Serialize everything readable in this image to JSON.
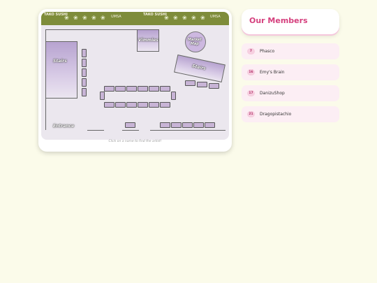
{
  "map": {
    "banner_text": "TAKO\nSUSHI",
    "logo_text": "UMSA",
    "labels": {
      "stairs_left": "Stairs",
      "stairs_right": "Stairs",
      "vimmies": "Vimmies",
      "market_map": "Market\nMap",
      "entrance": "Entrance"
    },
    "hint": "Click on a name to find the artist!"
  },
  "members": {
    "title": "Our Members",
    "items": [
      {
        "number": "7",
        "name": "Phasco"
      },
      {
        "number": "16",
        "name": "Emy's Brain"
      },
      {
        "number": "17",
        "name": "DanizuShop"
      },
      {
        "number": "21",
        "name": "Dragopistachio"
      }
    ]
  },
  "colors": {
    "background": "#fbfbea",
    "accent": "#d5407e",
    "banner": "#7e8c3a",
    "booth": "#c8b4d6"
  }
}
